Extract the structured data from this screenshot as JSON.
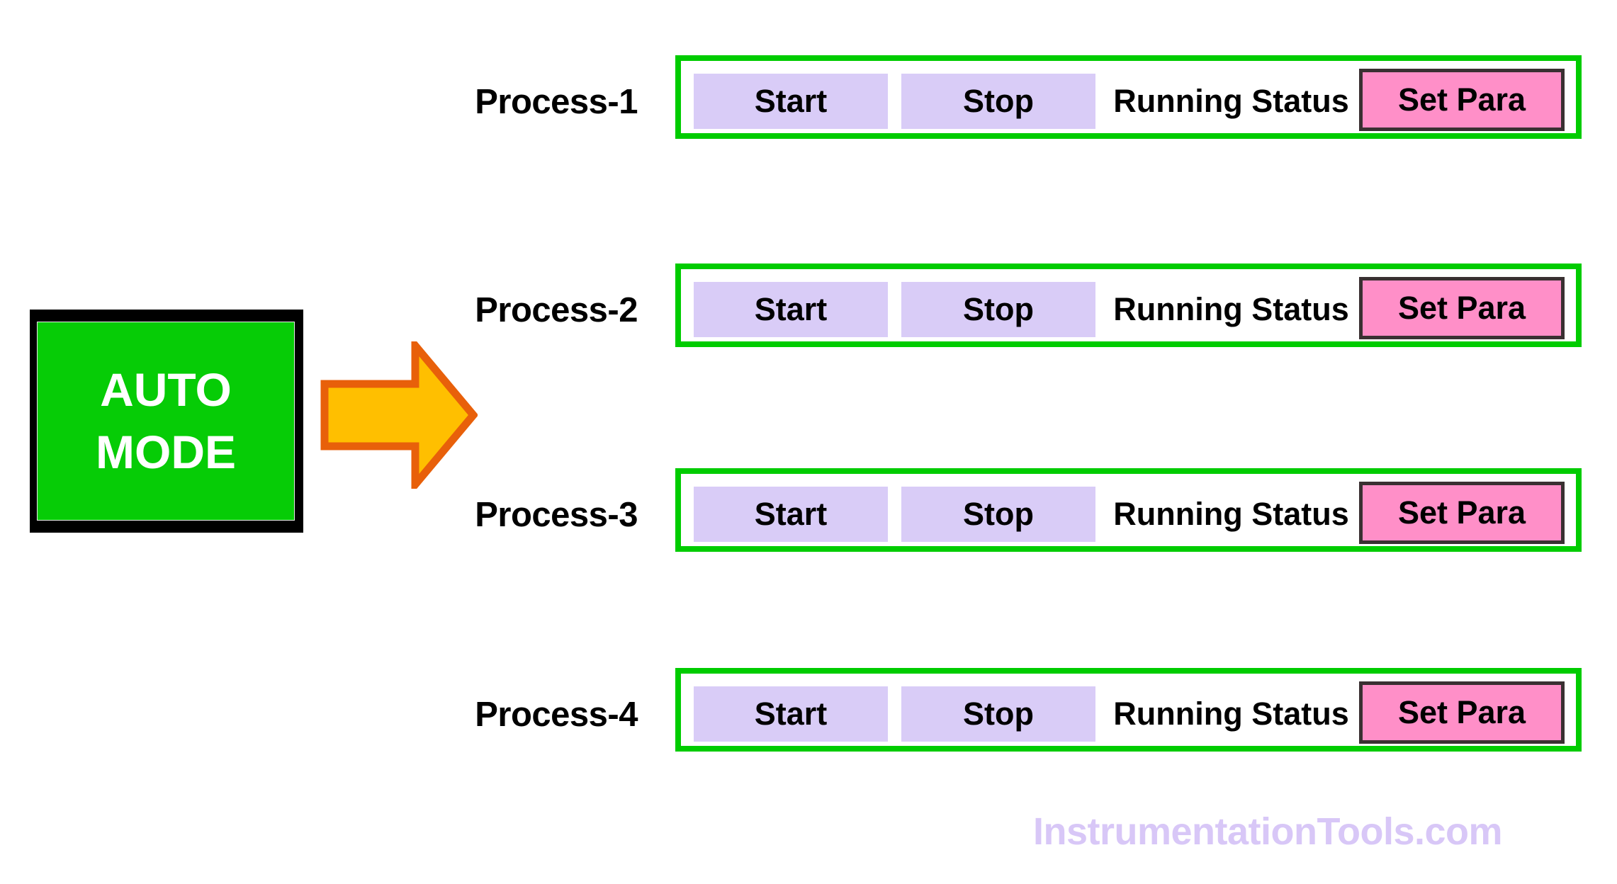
{
  "mode_panel": {
    "line1": "AUTO",
    "line2": "MODE",
    "fill_color": "#06CC06",
    "border_color": "#000000",
    "text_color": "#FFFFFF"
  },
  "arrow": {
    "icon": "arrow-right-icon",
    "direction": "right",
    "fill_color": "#FFBF00",
    "stroke_color": "#E8600A"
  },
  "row_style": {
    "box_border_color": "#00CC00",
    "button_color": "#D9CCF7",
    "setpara_color": "#FF8FC8",
    "setpara_border_color": "#3A3032"
  },
  "processes": [
    {
      "label": "Process-1",
      "start_label": "Start",
      "stop_label": "Stop",
      "status_label": "Running Status",
      "setpara_label": "Set Para"
    },
    {
      "label": "Process-2",
      "start_label": "Start",
      "stop_label": "Stop",
      "status_label": "Running Status",
      "setpara_label": "Set Para"
    },
    {
      "label": "Process-3",
      "start_label": "Start",
      "stop_label": "Stop",
      "status_label": "Running Status",
      "setpara_label": "Set Para"
    },
    {
      "label": "Process-4",
      "start_label": "Start",
      "stop_label": "Stop",
      "status_label": "Running Status",
      "setpara_label": "Set Para"
    }
  ],
  "watermark": {
    "text": "InstrumentationTools.com",
    "color": "#D8C7F7"
  }
}
